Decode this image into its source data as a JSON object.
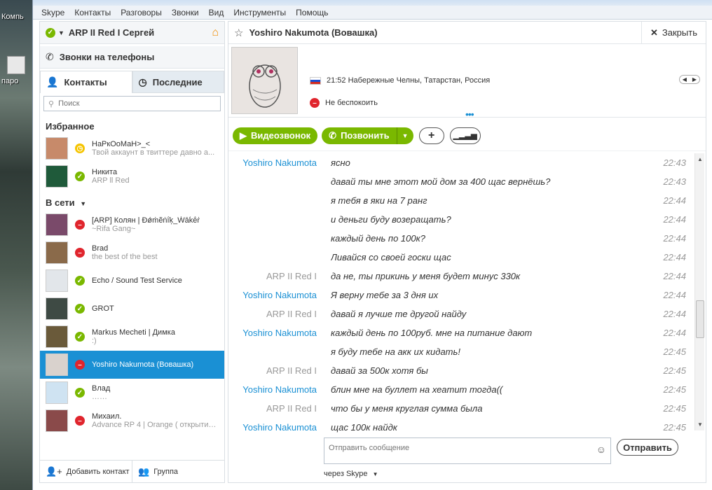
{
  "desktop": {
    "label_top": "Компь",
    "label_mid": "паро"
  },
  "menu": [
    "Skype",
    "Контакты",
    "Разговоры",
    "Звонки",
    "Вид",
    "Инструменты",
    "Помощь"
  ],
  "profile": {
    "name": "ARP II Red I Сергей"
  },
  "phone": {
    "label": "Звонки на телефоны"
  },
  "tabs": {
    "contacts": "Контакты",
    "recent": "Последние"
  },
  "search": {
    "placeholder": "Поиск"
  },
  "favorites": {
    "title": "Избранное",
    "items": [
      {
        "name": "НаРкОоМаН>_<",
        "sub": "Твой аккаунт в твиттере давно а...",
        "status": "away",
        "avatar": "#c78a6a"
      },
      {
        "name": "Никита",
        "sub": "ARP ll Red",
        "status": "online",
        "avatar": "#1f5a3a"
      }
    ]
  },
  "online": {
    "title": "В сети",
    "items": [
      {
        "name": "[ARP] Колян | Ɖǿṁẽṅḯķ_Ẃāḱḕṙ",
        "sub": "~Rifa Gang~",
        "status": "dnd",
        "avatar": "#7a4a6a",
        "selected": false
      },
      {
        "name": "Brad",
        "sub": "the best of the best",
        "status": "dnd",
        "avatar": "#8a6a4a",
        "selected": false
      },
      {
        "name": "Echo / Sound Test Service",
        "sub": "",
        "status": "online",
        "avatar": "#e2e6ea",
        "selected": false
      },
      {
        "name": "GROT",
        "sub": "",
        "status": "online",
        "avatar": "#3e4a44",
        "selected": false
      },
      {
        "name": "Markus Mecheti | Димка",
        "sub": ":)",
        "status": "online",
        "avatar": "#6a5a3a",
        "selected": false
      },
      {
        "name": "Yoshiro Nakumota (Вовашка)",
        "sub": "",
        "status": "dnd",
        "avatar": "#d9d2cd",
        "selected": true
      },
      {
        "name": "Влад",
        "sub": "……",
        "status": "online",
        "avatar": "#cfe3f2",
        "selected": false
      },
      {
        "name": "Михаил.",
        "sub": "Advance RP 4 | Orange ( открытие...",
        "status": "dnd",
        "avatar": "#8a4a4a",
        "selected": false
      }
    ]
  },
  "bottom": {
    "add_contact": "Добавить контакт",
    "group": "Группа"
  },
  "conversation": {
    "title": "Yoshiro Nakumota (Вовашка)",
    "close": "Закрыть",
    "location": "21:52 Набережные Челны, Татарстан, Россия",
    "status_text": "Не беспокоить",
    "video_btn": "Видеозвонок",
    "call_btn": "Позвонить",
    "send_btn": "Отправить",
    "compose_placeholder": "Отправить сообщение",
    "via": "через Skype"
  },
  "messages": [
    {
      "sender": "Yoshiro Nakumota",
      "who": "them",
      "text": "ясно",
      "time": "22:43"
    },
    {
      "sender": "",
      "who": "them",
      "text": "давай ты мне этот мой дом за 400 щас вернёшь?",
      "time": "22:43"
    },
    {
      "sender": "",
      "who": "them",
      "text": "я тебя в яки на 7 ранг",
      "time": "22:44"
    },
    {
      "sender": "",
      "who": "them",
      "text": "и деньги буду возеращать?",
      "time": "22:44"
    },
    {
      "sender": "",
      "who": "them",
      "text": "каждый день по 100к?",
      "time": "22:44"
    },
    {
      "sender": "",
      "who": "them",
      "text": "Ливайся со своей госки щас",
      "time": "22:44"
    },
    {
      "sender": "ARP II Red I",
      "who": "me",
      "text": "да не, ты прикинь у меня будет минус 330к",
      "time": "22:44"
    },
    {
      "sender": "Yoshiro Nakumota",
      "who": "them",
      "text": "Я верну тебе за 3 дня их",
      "time": "22:44"
    },
    {
      "sender": "ARP II Red I",
      "who": "me",
      "text": "давай я лучше те другой найду",
      "time": "22:44"
    },
    {
      "sender": "Yoshiro Nakumota",
      "who": "them",
      "text": "каждый день по 100руб. мне на питание дают",
      "time": "22:44"
    },
    {
      "sender": "",
      "who": "them",
      "text": "я буду тебе на акк их кидать!",
      "time": "22:45"
    },
    {
      "sender": "ARP II Red I",
      "who": "me",
      "text": "давай за 500к хотя бы",
      "time": "22:45"
    },
    {
      "sender": "Yoshiro Nakumota",
      "who": "them",
      "text": "блин мне на буллет на хеатит тогда((",
      "time": "22:45"
    },
    {
      "sender": "ARP II Red I",
      "who": "me",
      "text": "что бы у меня круглая сумма была",
      "time": "22:45"
    },
    {
      "sender": "Yoshiro Nakumota",
      "who": "them",
      "text": "щас 100к найдк",
      "time": "22:45"
    }
  ]
}
